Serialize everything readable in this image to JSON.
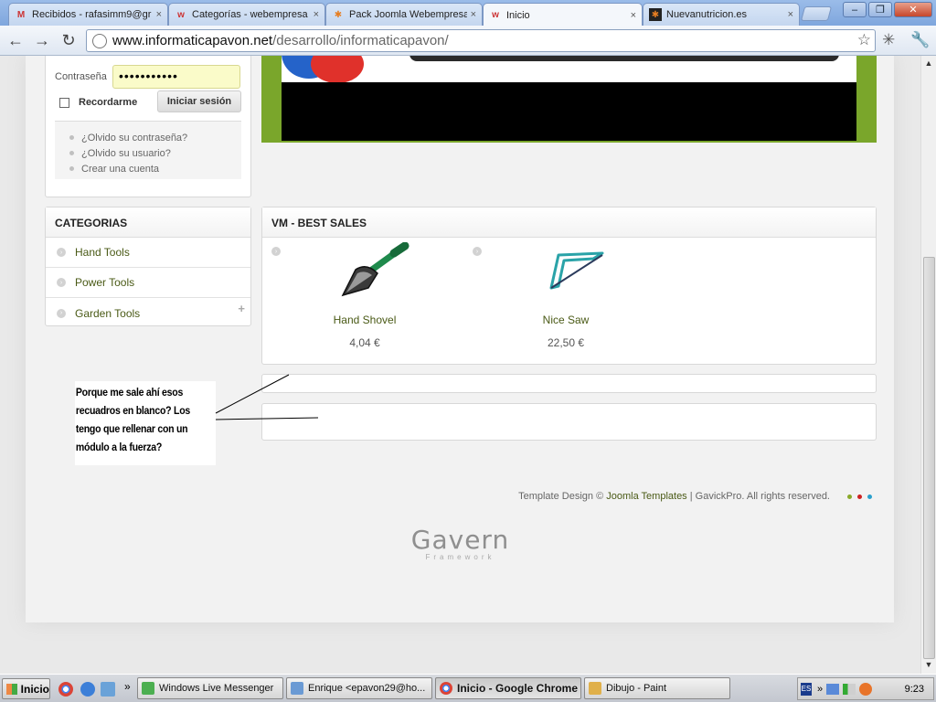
{
  "browser": {
    "tabs": [
      {
        "label": "Recibidos - rafasimm9@gr",
        "icon": "gmail-icon",
        "active": false
      },
      {
        "label": "Categorías - webempresa",
        "icon": "webempresa-icon",
        "active": false
      },
      {
        "label": "Pack Joomla Webempresa",
        "icon": "joomla-icon",
        "active": false
      },
      {
        "label": "Inicio",
        "icon": "webempresa-icon",
        "active": true
      },
      {
        "label": "Nuevanutricion.es",
        "icon": "joomla-icon",
        "active": false
      }
    ],
    "close_glyph": "×",
    "url_host": "www.informaticapavon.net",
    "url_path": "/desarrollo/informaticapavon/"
  },
  "login": {
    "password_label": "Contraseña",
    "password_value": "•••••••••••",
    "remember_label": "Recordarme",
    "submit_label": "Iniciar sesión",
    "links": [
      "¿Olvido su contraseña?",
      "¿Olvido su usuario?",
      "Crear una cuenta"
    ]
  },
  "categories": {
    "title": "CATEGORIAS",
    "items": [
      "Hand Tools",
      "Power Tools",
      "Garden Tools"
    ]
  },
  "best_sales": {
    "title": "VM - BEST SALES",
    "products": [
      {
        "name": "Hand Shovel",
        "price": "4,04 €",
        "icon": "shovel-icon"
      },
      {
        "name": "Nice Saw",
        "price": "22,50 €",
        "icon": "saw-icon"
      }
    ]
  },
  "annotation": {
    "lines": [
      "Porque me sale ahí esos",
      "recuadros en blanco? Los",
      "tengo que rellenar con un",
      "módulo a la fuerza?"
    ]
  },
  "footer": {
    "prefix": "Template Design © ",
    "link": "Joomla Templates",
    "suffix": " | GavickPro. All rights reserved.",
    "dot_colors": [
      "#8aaa2a",
      "#cc2222",
      "#2aa0cc"
    ]
  },
  "brand": {
    "logo": "Gavern",
    "sub": "Framework"
  },
  "taskbar": {
    "start_label": "Inicio",
    "chevron": "»",
    "buttons": [
      {
        "label": "Windows Live Messenger",
        "active": false
      },
      {
        "label": "Enrique <epavon29@ho...",
        "active": false
      },
      {
        "label": "Inicio - Google Chrome",
        "active": true
      },
      {
        "label": "Dibujo - Paint",
        "active": false
      }
    ],
    "lang": "ES",
    "clock": "9:23"
  }
}
